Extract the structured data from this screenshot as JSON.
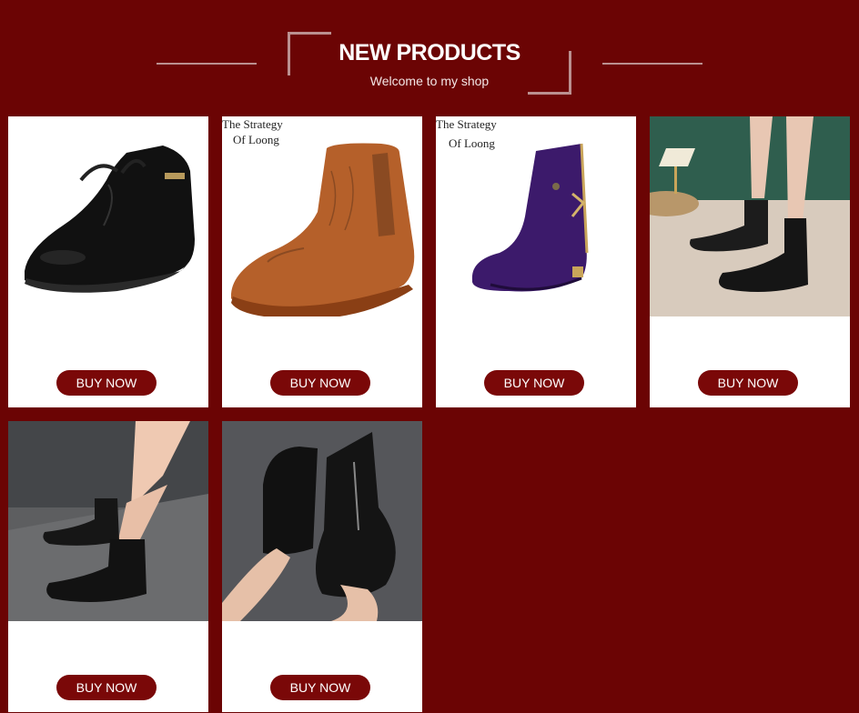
{
  "header": {
    "title": "NEW PRODUCTS",
    "subtitle": "Welcome to my shop"
  },
  "colors": {
    "background": "#6b0404",
    "button": "#7a0808",
    "card": "#ffffff"
  },
  "products": [
    {
      "image": "black-leather-lace-boot",
      "button_label": "BUY NOW"
    },
    {
      "image": "tan-leather-chelsea-boot",
      "watermark_line1": "The Strategy",
      "watermark_line2": "Of Loong",
      "button_label": "BUY NOW"
    },
    {
      "image": "purple-suede-boot",
      "watermark_line1": "The Strategy",
      "watermark_line2": "Of Loong",
      "button_label": "BUY NOW"
    },
    {
      "image": "black-chelsea-boots-worn",
      "button_label": "BUY NOW"
    },
    {
      "image": "black-zip-boots-worn",
      "button_label": "BUY NOW"
    },
    {
      "image": "black-zip-boot-in-hand",
      "button_label": "BUY NOW"
    }
  ]
}
